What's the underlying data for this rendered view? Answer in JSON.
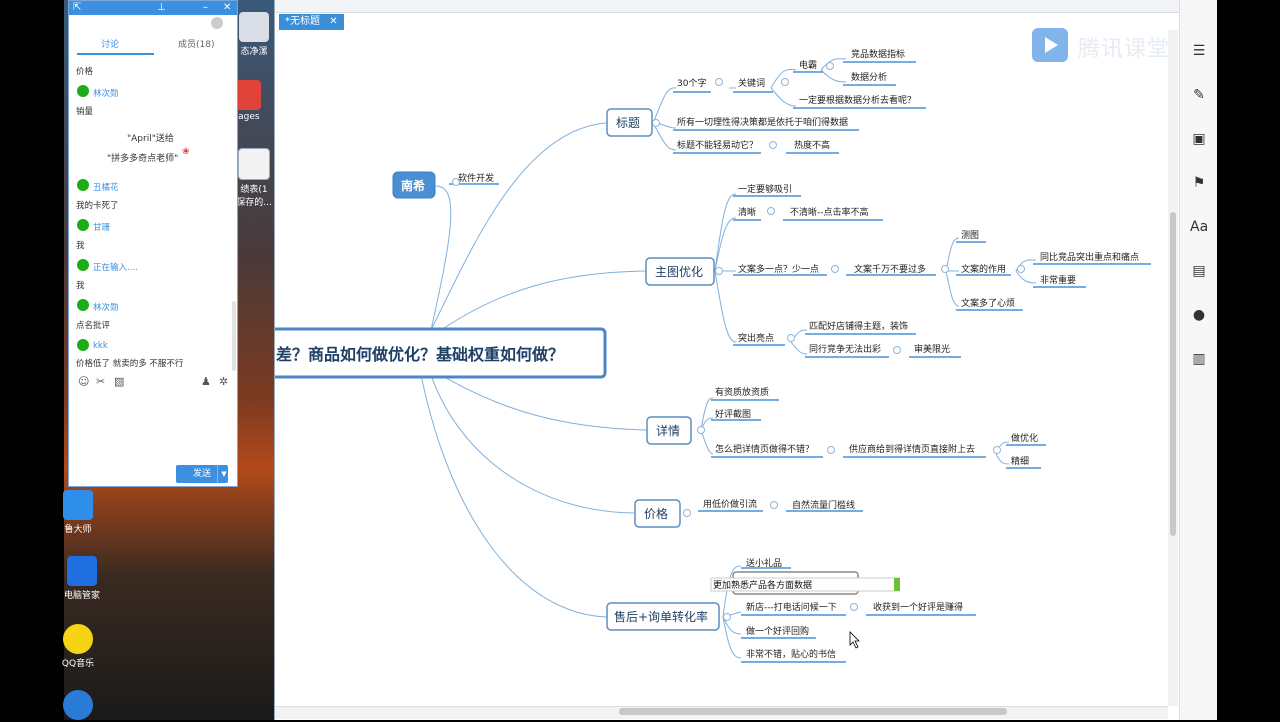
{
  "chat": {
    "tabs": [
      "讨论",
      "成员(18)"
    ],
    "messages": [
      {
        "text": "价格"
      },
      {
        "name": "林次勋",
        "text": "销量"
      },
      {
        "name": "丑橘花",
        "text": "我的卡死了"
      },
      {
        "name": "甘珊",
        "text": "我"
      },
      {
        "name": "正在输入....",
        "text": "我"
      },
      {
        "name": "林次勋",
        "text": "点名批评"
      },
      {
        "name": "kkk",
        "text": "价格低了 就卖的多 不服不行"
      }
    ],
    "gift_line1": "\"April\"送给",
    "gift_line2": "\"拼多多奇点老师\"",
    "send_label": "发送"
  },
  "desktop": {
    "icons": [
      "态净漯",
      "nages",
      "绩表(1",
      "保存的...",
      "鲁大师",
      "电脑管家",
      "QQ音乐"
    ]
  },
  "editor": {
    "tab_title": "*无标题"
  },
  "watermark": {
    "text": "腾讯课堂"
  },
  "mindmap": {
    "central": "差？商品如何做优化？基础权重如何做？",
    "nanxi": "南希",
    "nanxi_child": "软件开发",
    "title_node": "标题",
    "t_30": "30个字",
    "t_kw": "关键词",
    "t_ds": "电霸",
    "t_jp": "竞品数据指标",
    "t_sj": "数据分析",
    "t_yd": "一定要根据数据分析去看呢？",
    "t_all": "所有一切理性得决策都是依托于咱们得数据",
    "t_bn": "标题不能轻易动它？",
    "t_rd": "热度不高",
    "main_node": "主图优化",
    "m_xy": "一定要够吸引",
    "m_qx": "清晰",
    "m_bq": "不清晰--点击率不高",
    "m_wa": "文案多一点？少一点",
    "m_qw": "文案千万不要过多",
    "m_ct": "测图",
    "m_zy": "文案的作用",
    "m_tb": "同比竞品突出重点和痛点",
    "m_fc": "非常重要",
    "m_xf": "文案多了心烦",
    "m_tc": "突出亮点",
    "m_pp": "匹配好店铺得主题，装饰",
    "m_tx": "同行竞争无法出彩",
    "m_sm": "审美限光",
    "detail_node": "详情",
    "d_zz": "有资质放资质",
    "d_hp": "好评截图",
    "d_zm": "怎么把详情页做得不错？",
    "d_gy": "供应商给到得详情页直接附上去",
    "d_yh": "做优化",
    "d_jx": "精细",
    "price_node": "价格",
    "p_dj": "用低价做引流",
    "p_zr": "自然流量门槛线",
    "after_node": "售后+询单转化率",
    "a_lp": "送小礼品",
    "a_edit": "更加熟悉产品各方面数据",
    "a_xd": "新店---打电话问候一下",
    "a_hp": "收获到一个好评是赚得",
    "a_hg": "做一个好评回购",
    "a_sx": "非常不错，贴心的书信"
  },
  "colors": {
    "accent": "#3d8fe0",
    "node_border": "#5b8ec0",
    "node_text": "#1f3f66",
    "central_border": "#4a86c8",
    "line": "#7fb0dc"
  }
}
